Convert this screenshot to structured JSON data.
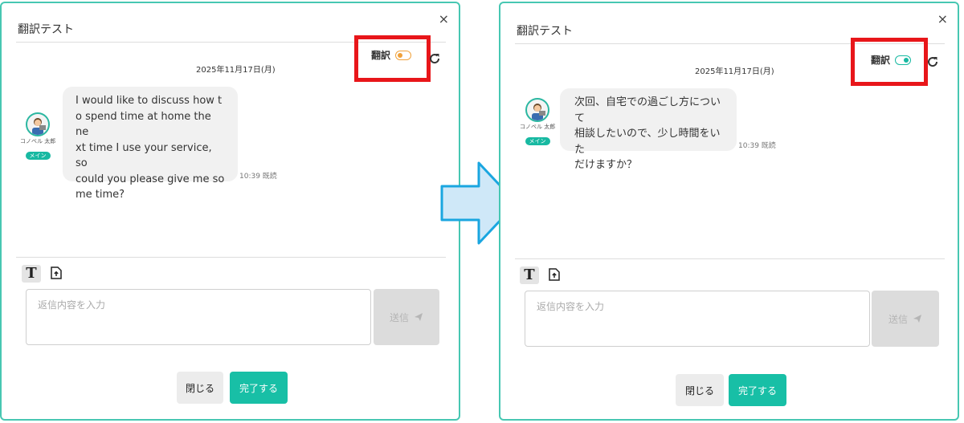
{
  "left": {
    "title": "翻訳テスト",
    "close": "×",
    "toggle_label": "翻訳",
    "toggle_state": "off",
    "date": "2025年11月17日(月)",
    "user_name": "コノベル 太郎",
    "user_badge": "メイン",
    "message_lines": [
      "I would like to discuss how t",
      "o spend time at home the ne",
      "xt time I use your service, so",
      "could you please give me so",
      "me time?"
    ],
    "time_read": "10:39 既読",
    "reply_placeholder": "返信内容を入力",
    "send_label": "送信",
    "btn_close": "閉じる",
    "btn_done": "完了する"
  },
  "right": {
    "title": "翻訳テスト",
    "close": "×",
    "toggle_label": "翻訳",
    "toggle_state": "on",
    "date": "2025年11月17日(月)",
    "user_name": "コノベル 太郎",
    "user_badge": "メイン",
    "message_lines": [
      "次回、自宅での過ごし方について",
      "相談したいので、少し時間をいた",
      "だけますか？"
    ],
    "time_read": "10:39 既読",
    "reply_placeholder": "返信内容を入力",
    "send_label": "送信",
    "btn_close": "閉じる",
    "btn_done": "完了する"
  },
  "colors": {
    "accent": "#18b9a2",
    "highlight": "#e8161a",
    "toggle_off": "#f0a13a",
    "arrow_fill": "#cfe8f8",
    "arrow_stroke": "#1aa6e0"
  },
  "icons": [
    "close-icon",
    "refresh-icon",
    "text-format-icon",
    "file-upload-icon",
    "send-icon",
    "arrow-right-icon"
  ]
}
